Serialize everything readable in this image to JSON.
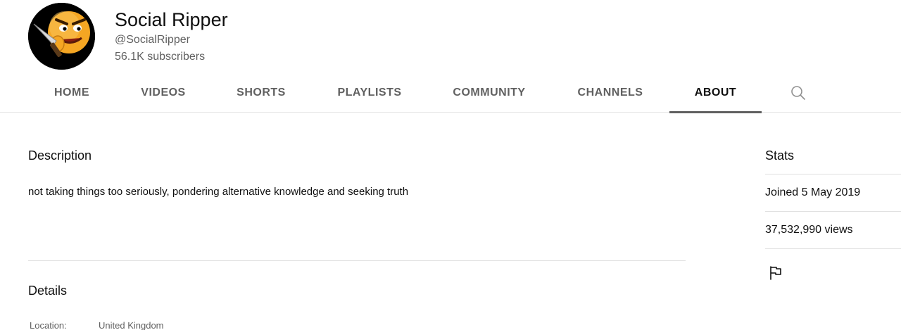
{
  "channel": {
    "name": "Social Ripper",
    "handle": "@SocialRipper",
    "subscribers": "56.1K subscribers",
    "avatar_icon": "knife-emoji-avatar-icon"
  },
  "tabs": [
    {
      "label": "HOME",
      "active": false
    },
    {
      "label": "VIDEOS",
      "active": false
    },
    {
      "label": "SHORTS",
      "active": false
    },
    {
      "label": "PLAYLISTS",
      "active": false
    },
    {
      "label": "COMMUNITY",
      "active": false
    },
    {
      "label": "CHANNELS",
      "active": false
    },
    {
      "label": "ABOUT",
      "active": true
    }
  ],
  "search_icon": "search-icon",
  "about": {
    "description_title": "Description",
    "description_text": "not taking things too seriously, pondering alternative knowledge and seeking truth",
    "details_title": "Details",
    "details": [
      {
        "label": "Location:",
        "value": "United Kingdom"
      }
    ]
  },
  "stats": {
    "title": "Stats",
    "joined": "Joined 5 May 2019",
    "views": "37,532,990 views",
    "report_icon": "flag-icon"
  },
  "colors": {
    "text_primary": "#0f0f0f",
    "text_secondary": "#606060",
    "divider": "#e5e5e5",
    "active_tab_indicator": "#606060",
    "avatar_background": "#000000",
    "avatar_face": "#f5a623"
  }
}
